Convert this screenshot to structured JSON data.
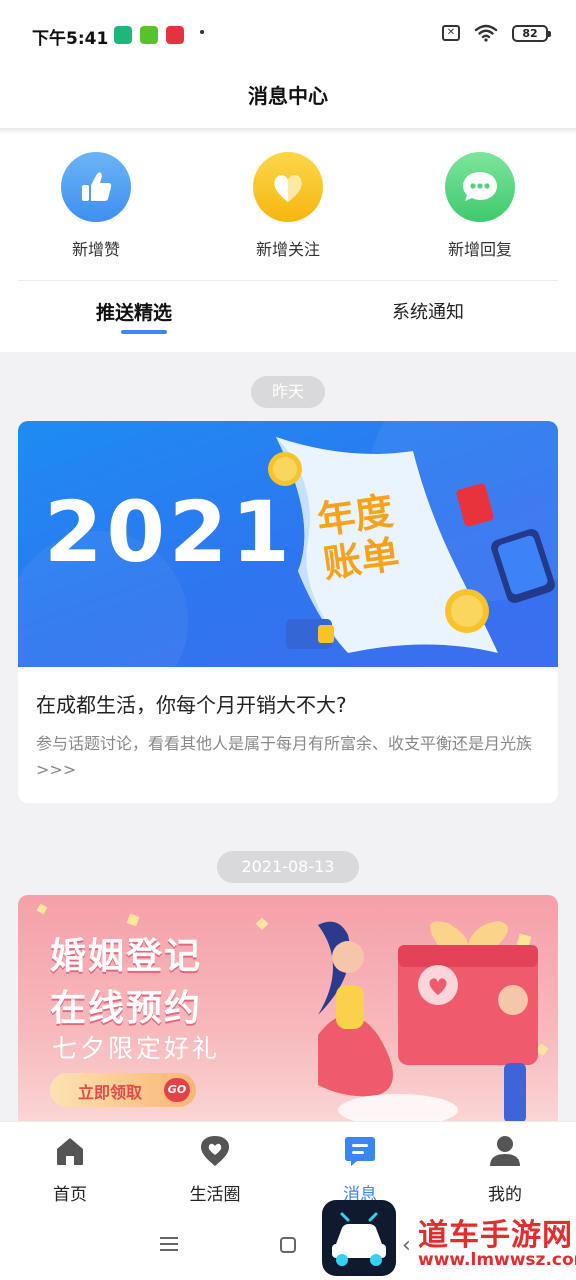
{
  "status_bar": {
    "time": "下午5:41",
    "app_icons": [
      {
        "name": "shield-app-icon",
        "color": "#1fb67a"
      },
      {
        "name": "download-app-icon",
        "color": "#58c22c"
      },
      {
        "name": "news-app-icon",
        "color": "#e5323f"
      }
    ],
    "battery": "82"
  },
  "header": {
    "title": "消息中心"
  },
  "quick_actions": [
    {
      "label": "新增赞",
      "icon": "thumbs-up-icon",
      "color": "#3f97f2"
    },
    {
      "label": "新增关注",
      "icon": "heart-icon",
      "color": "#f9c21a"
    },
    {
      "label": "新增回复",
      "icon": "chat-bubble-icon",
      "color": "#4fd37a"
    }
  ],
  "tabs": [
    {
      "label": "推送精选",
      "active": true
    },
    {
      "label": "系统通知",
      "active": false
    }
  ],
  "feed": [
    {
      "date": "昨天",
      "banner": {
        "year": "2021",
        "art_text": "年度账单"
      },
      "title": "在成都生活，你每个月开销大不大?",
      "description": "参与话题讨论，看看其他人是属于每月有所富余、收支平衡还是月光族>>>"
    },
    {
      "date": "2021-08-13",
      "banner": {
        "headline_1": "婚姻登记",
        "headline_2": "在线预约",
        "subline": "七夕限定好礼",
        "button": "立即领取",
        "button_badge": "GO"
      }
    }
  ],
  "bottom_nav": [
    {
      "label": "首页",
      "icon": "home-icon",
      "active": false
    },
    {
      "label": "生活圈",
      "icon": "heart-location-icon",
      "active": false
    },
    {
      "label": "消息",
      "icon": "message-icon",
      "active": true
    },
    {
      "label": "我的",
      "icon": "profile-icon",
      "active": false
    }
  ],
  "watermark": {
    "text": "道车手游网",
    "url": "www.lmwwsz.com"
  },
  "colors": {
    "accent": "#3a86f2",
    "inactive_icon": "#555555"
  }
}
